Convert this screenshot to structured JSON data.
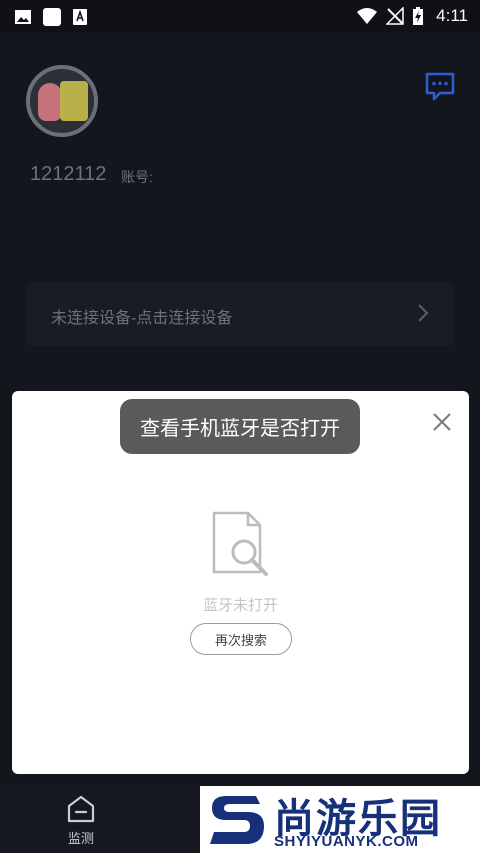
{
  "status_bar": {
    "time": "4:11"
  },
  "profile": {
    "user_id": "1212112",
    "account_label": "账号:"
  },
  "connect": {
    "text": "未连接设备-点击连接设备"
  },
  "dialog": {
    "empty_text": "蓝牙未打开",
    "retry_label": "再次搜索"
  },
  "toast": {
    "text": "查看手机蓝牙是否打开"
  },
  "bottom_nav": {
    "tabs": [
      {
        "label": "监测",
        "icon": "monitor-icon"
      }
    ]
  },
  "watermark": {
    "cn": "尚游乐园",
    "en": "SHYIYUANYK.COM"
  },
  "colors": {
    "background": "#13161d",
    "dialog": "#ffffff",
    "toast": "#5a5a5a",
    "accent": "#2f5bd6"
  }
}
